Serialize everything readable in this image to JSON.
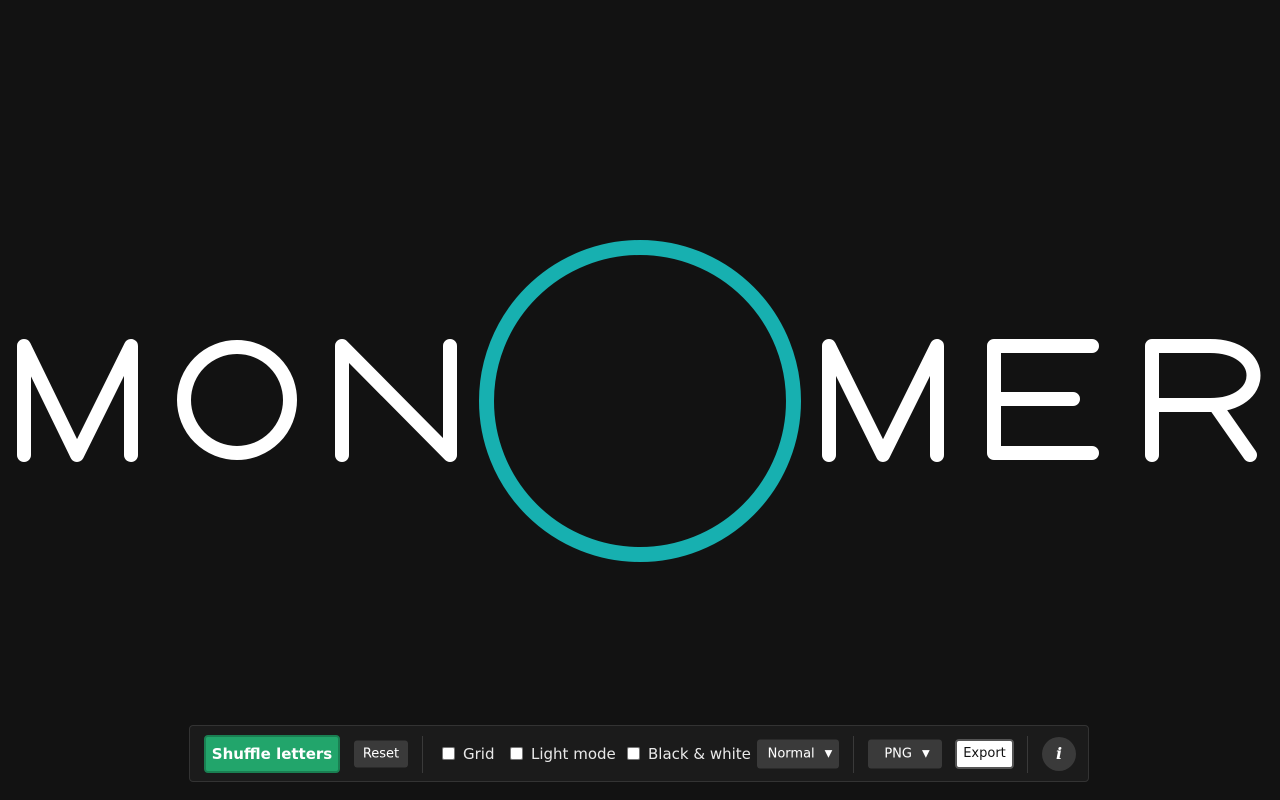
{
  "logo": {
    "letters": [
      "M",
      "O",
      "N",
      "O",
      "M",
      "E",
      "R"
    ],
    "letter_color": "#ffffff",
    "accent_letter_index": 3,
    "accent_color": "#17b0b0",
    "background": "#121212"
  },
  "toolbar": {
    "shuffle_label": "Shuffle letters",
    "reset_label": "Reset",
    "grid_label": "Grid",
    "grid_checked": false,
    "light_mode_label": "Light mode",
    "light_mode_checked": false,
    "bw_label": "Black & white",
    "bw_checked": false,
    "mode_select_value": "Normal",
    "format_select_value": "PNG",
    "export_label": "Export",
    "info_label": "i",
    "shuffle_color": "#22a56b"
  }
}
